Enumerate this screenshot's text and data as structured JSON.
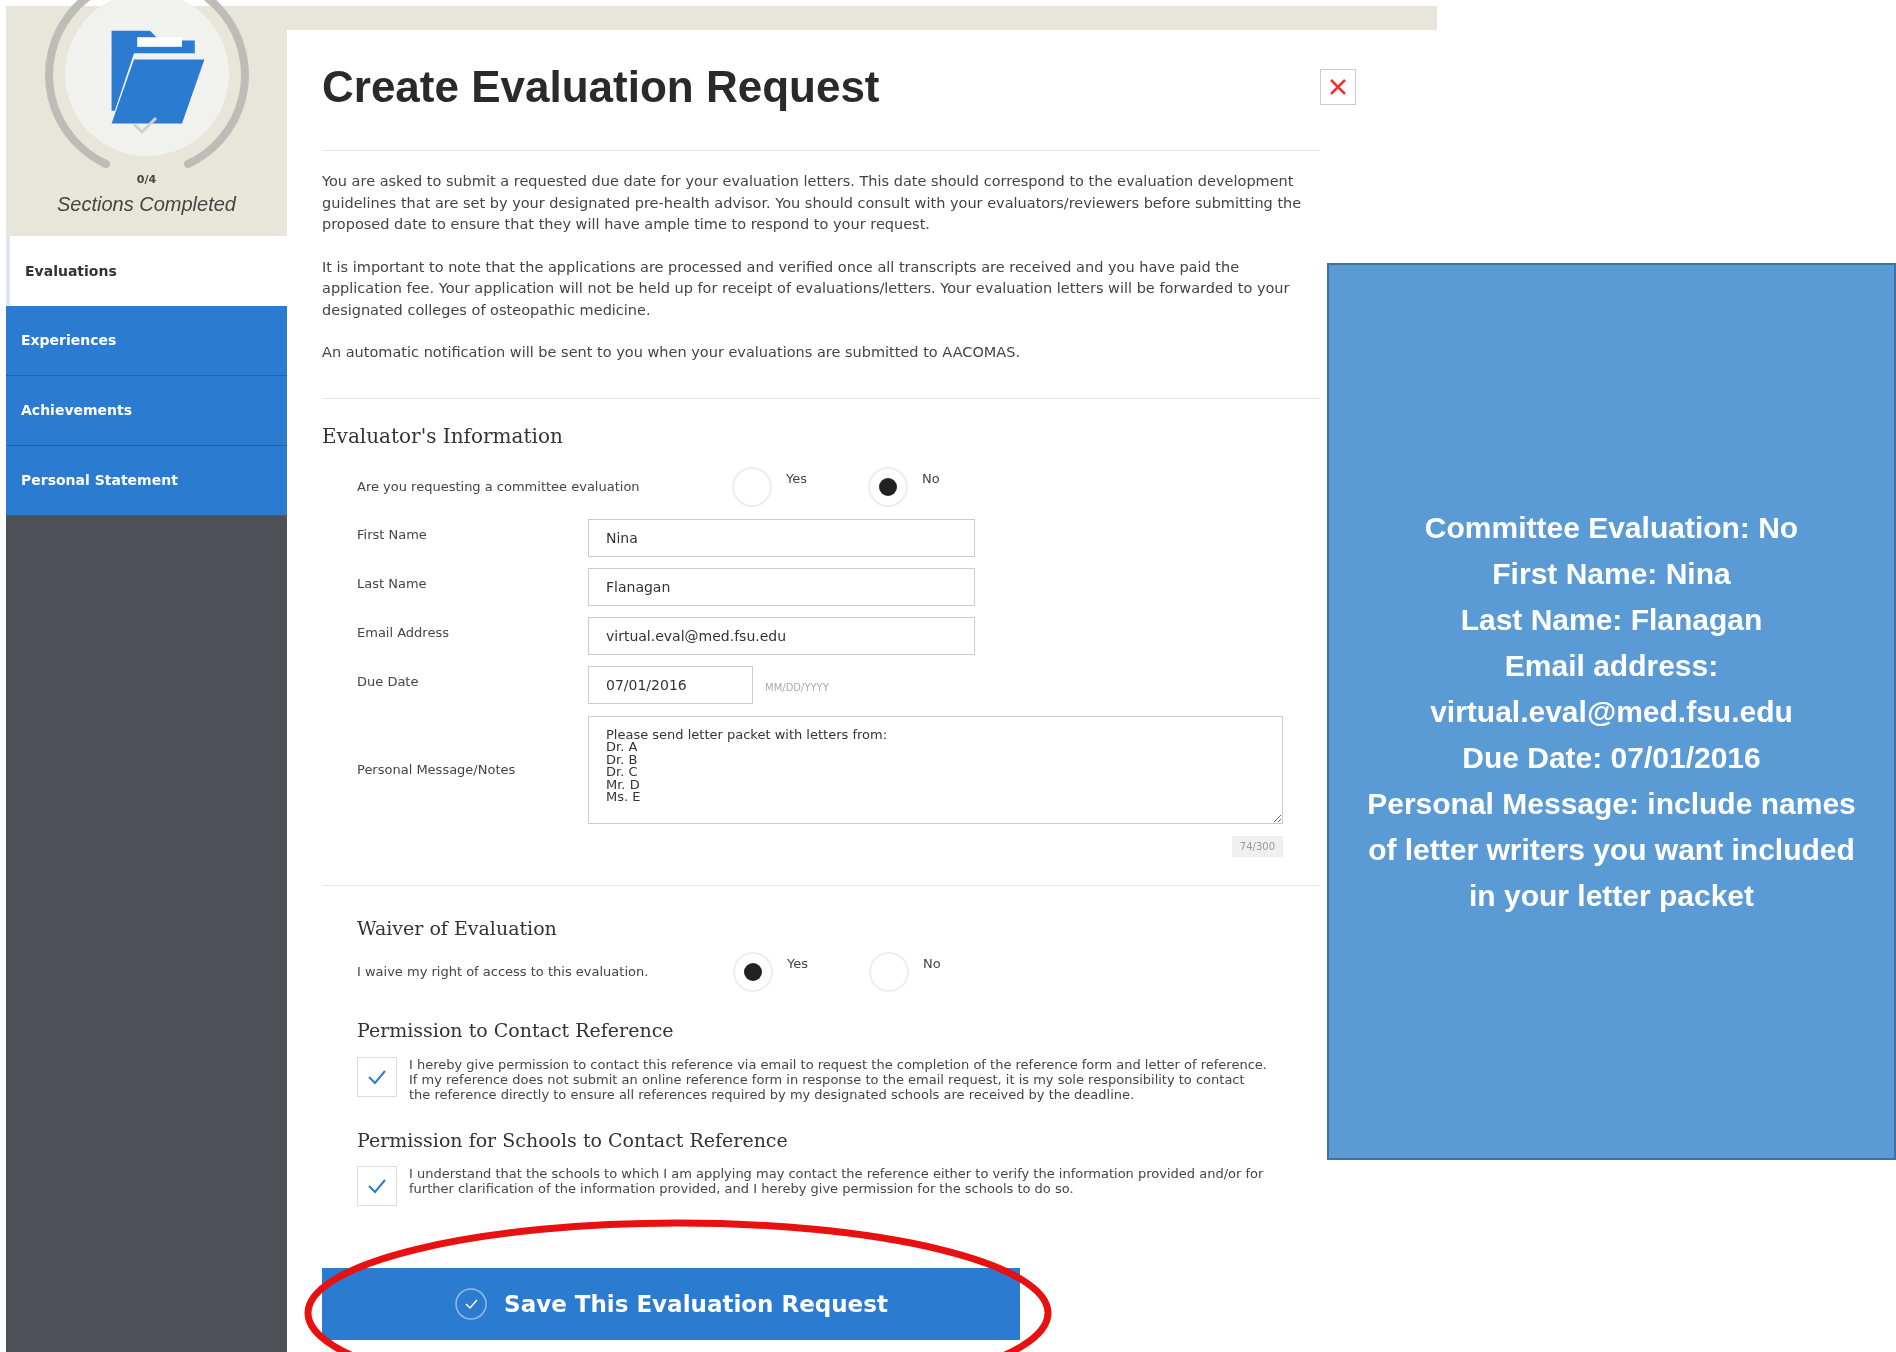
{
  "sidebar": {
    "progress": "0/4",
    "progress_label": "Sections Completed",
    "items": [
      {
        "label": "Evaluations",
        "selected": true
      },
      {
        "label": "Experiences",
        "selected": false
      },
      {
        "label": "Achievements",
        "selected": false
      },
      {
        "label": "Personal Statement",
        "selected": false
      }
    ]
  },
  "dialog": {
    "title": "Create Evaluation Request",
    "intro": [
      "You are asked to submit a requested due date for your evaluation letters. This date should correspond to the evaluation development guidelines that are set by your designated pre-health advisor. You should consult with your evaluators/reviewers before submitting the proposed date to ensure that they will have ample time to respond to your request.",
      "It is important to note that the applications are processed and verified once all transcripts are received and you have paid the application fee. Your application will not be held up for receipt of evaluations/letters. Your evaluation letters will be forwarded to your designated colleges of osteopathic medicine.",
      "An automatic notification will be sent to you when your evaluations are submitted to AACOMAS."
    ],
    "evaluator": {
      "heading": "Evaluator's Information",
      "committee": {
        "question": "Are you requesting a committee evaluation",
        "options": [
          {
            "label": "Yes",
            "selected": false
          },
          {
            "label": "No",
            "selected": true
          }
        ]
      },
      "fields": [
        {
          "kind": "text",
          "label": "First Name",
          "value": "Nina"
        },
        {
          "kind": "text",
          "label": "Last Name",
          "value": "Flanagan"
        },
        {
          "kind": "text",
          "label": "Email Address",
          "value": "virtual.eval@med.fsu.edu"
        },
        {
          "kind": "date",
          "label": "Due Date",
          "value": "07/01/2016",
          "hint": "MM/DD/YYYY"
        }
      ],
      "message": {
        "label": "Personal Message/Notes",
        "value": "Please send letter packet with letters from:\nDr. A\nDr. B\nDr. C\nMr. D\nMs. E",
        "counter": "74/300"
      }
    },
    "waiver": {
      "heading": "Waiver of Evaluation",
      "question": "I waive my right of access to this evaluation.",
      "options": [
        {
          "label": "Yes",
          "selected": true
        },
        {
          "label": "No",
          "selected": false
        }
      ]
    },
    "permissions": [
      {
        "heading": "Permission to Contact Reference",
        "text": "I hereby give permission to contact this reference via email to request the completion of the reference form and letter of reference. If my reference does not submit an online reference form in response to the email request, it is my sole responsibility to contact the reference directly to ensure all references required by my designated schools are received by the deadline.",
        "checked": true
      },
      {
        "heading": "Permission for Schools to Contact Reference",
        "text": "I understand that the schools to which I am applying may contact the reference either to verify the information provided and/or for further clarification of the information provided, and I hereby give permission for the schools to do so.",
        "checked": true
      }
    ],
    "save_button": "Save This Evaluation Request"
  },
  "callout": {
    "lines": [
      "Committee Evaluation: No",
      "First Name: Nina",
      "Last Name: Flanagan",
      "Email address: virtual.eval@med.fsu.edu",
      "Due Date: 07/01/2016",
      "Personal Message: include names of letter writers you want included in your letter packet"
    ]
  }
}
